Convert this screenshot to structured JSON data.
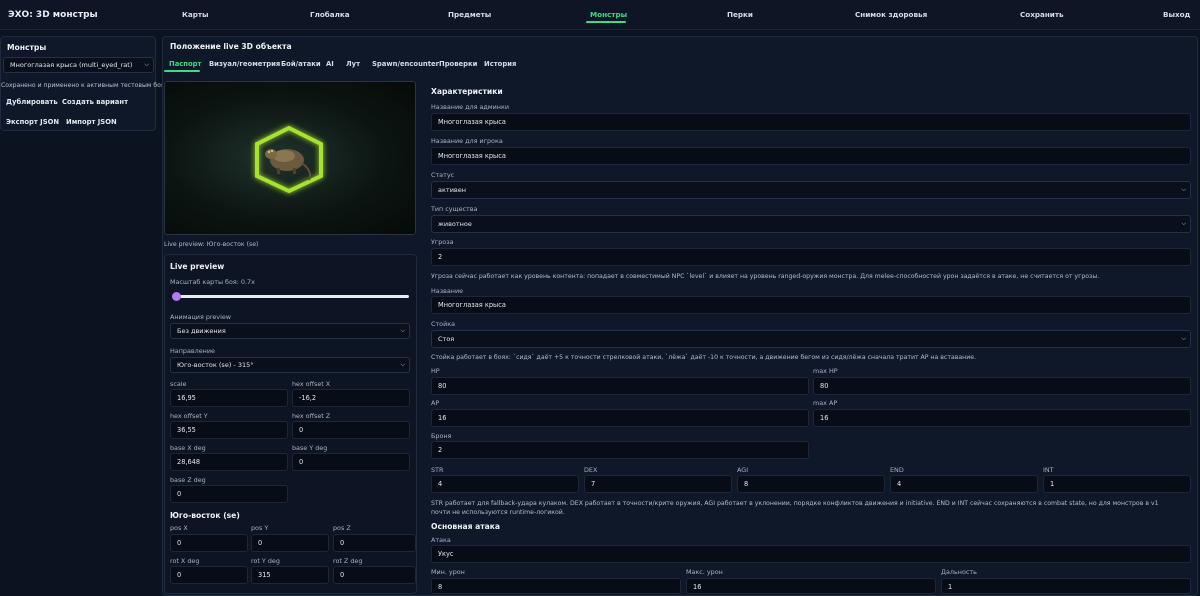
{
  "app": {
    "title": "ЭХО: 3D монстры"
  },
  "nav": {
    "items": [
      "Карты",
      "Глобалка",
      "Предметы",
      "Монстры",
      "Перки",
      "Снимок здоровья",
      "Сохранить",
      "Выход"
    ],
    "active": "Монстры"
  },
  "sidebar": {
    "title": "Монстры",
    "selected_monster": "Многоглазая крыса (multi_eyed_rat)",
    "status": "Сохранено и применено к активным тестовым боям",
    "duplicate_label": "Дублировать",
    "create_variant_label": "Создать вариант",
    "export_label": "Экспорт JSON",
    "import_label": "Импорт JSON"
  },
  "main": {
    "title": "Положение live 3D объекта",
    "tabs": [
      "Паспорт",
      "Визуал/геометрия",
      "Бой/атаки",
      "AI",
      "Лут",
      "Spawn/encounter",
      "Проверки",
      "История"
    ],
    "active_tab": "Паспорт"
  },
  "preview": {
    "caption": "Live preview: Юго-восток (se)",
    "accent": "#a6e22e"
  },
  "live_preview": {
    "title": "Live preview",
    "scale_label": "Масштаб карты боя: 0.7x",
    "scale_value": 0.0,
    "animation_label": "Анимация preview",
    "animation_value": "Без движения",
    "direction_label": "Направление",
    "direction_value": "Юго-восток (se) - 315°",
    "scale_field_label": "scale",
    "scale_field": "16,95",
    "hex_x_label": "hex offset X",
    "hex_x": "-16,2",
    "hex_y_label": "hex offset Y",
    "hex_y": "36,55",
    "hex_z_label": "hex offset Z",
    "hex_z": "0",
    "base_x_label": "base X deg",
    "base_x": "28,648",
    "base_y_label": "base Y deg",
    "base_y": "0",
    "base_z_label": "base Z deg",
    "base_z": "0",
    "se_title": "Юго-восток (se)",
    "pos_x_label": "pos X",
    "pos_x": "0",
    "pos_y_label": "pos Y",
    "pos_y": "0",
    "pos_z_label": "pos Z",
    "pos_z": "0",
    "rot_x_label": "rot X deg",
    "rot_x": "0",
    "rot_y_label": "rot Y deg",
    "rot_y": "315",
    "rot_z_label": "rot Z deg",
    "rot_z": "0"
  },
  "stats": {
    "title": "Характеристики",
    "admin_name_label": "Название для админки",
    "admin_name": "Многоглазая крыса",
    "player_name_label": "Название для игрока",
    "player_name": "Многоглазая крыса",
    "status_label": "Статус",
    "status_value": "активен",
    "creature_type_label": "Тип существа",
    "creature_type": "животное",
    "threat_label": "Угроза",
    "threat": "2",
    "threat_note": "Угроза сейчас работает как уровень контента: попадает в совместимый NPC `level` и влияет на уровень ranged-оружия монстра. Для melee-способностей урон задаётся в атаке, не считается от угрозы.",
    "name_label": "Название",
    "name": "Многоглазая крыса",
    "stance_label": "Стойка",
    "stance": "Стоя",
    "stance_note": "Стойка работает в боях: `сидя` даёт +5 к точности стрелковой атаки, `лёжа` даёт -10 к точности, а движение бегом из сидя/лёжа сначала тратит AP на вставание.",
    "hp_label": "HP",
    "hp": "80",
    "max_hp_label": "max HP",
    "max_hp": "80",
    "ap_label": "AP",
    "ap": "16",
    "max_ap_label": "max AP",
    "max_ap": "16",
    "armor_label": "Броня",
    "armor": "2",
    "str_label": "STR",
    "str": "4",
    "dex_label": "DEX",
    "dex": "7",
    "agi_label": "AGI",
    "agi": "8",
    "end_label": "END",
    "end": "4",
    "int_label": "INT",
    "int": "1",
    "attr_note": "STR работает для fallback-удара кулаком. DEX работает в точности/крите оружия, AGI работает в уклонении, порядке конфликтов движения и initiative. END и INT сейчас сохраняются в combat state, но для монстров в v1 почти не используются runtime-логикой.",
    "attack_title": "Основная атака",
    "attack_label": "Атака",
    "attack": "Укус",
    "min_dmg_label": "Мин. урон",
    "min_dmg": "8",
    "max_dmg_label": "Макс. урон",
    "max_dmg": "16",
    "range_label": "Дальность",
    "range": "1"
  }
}
